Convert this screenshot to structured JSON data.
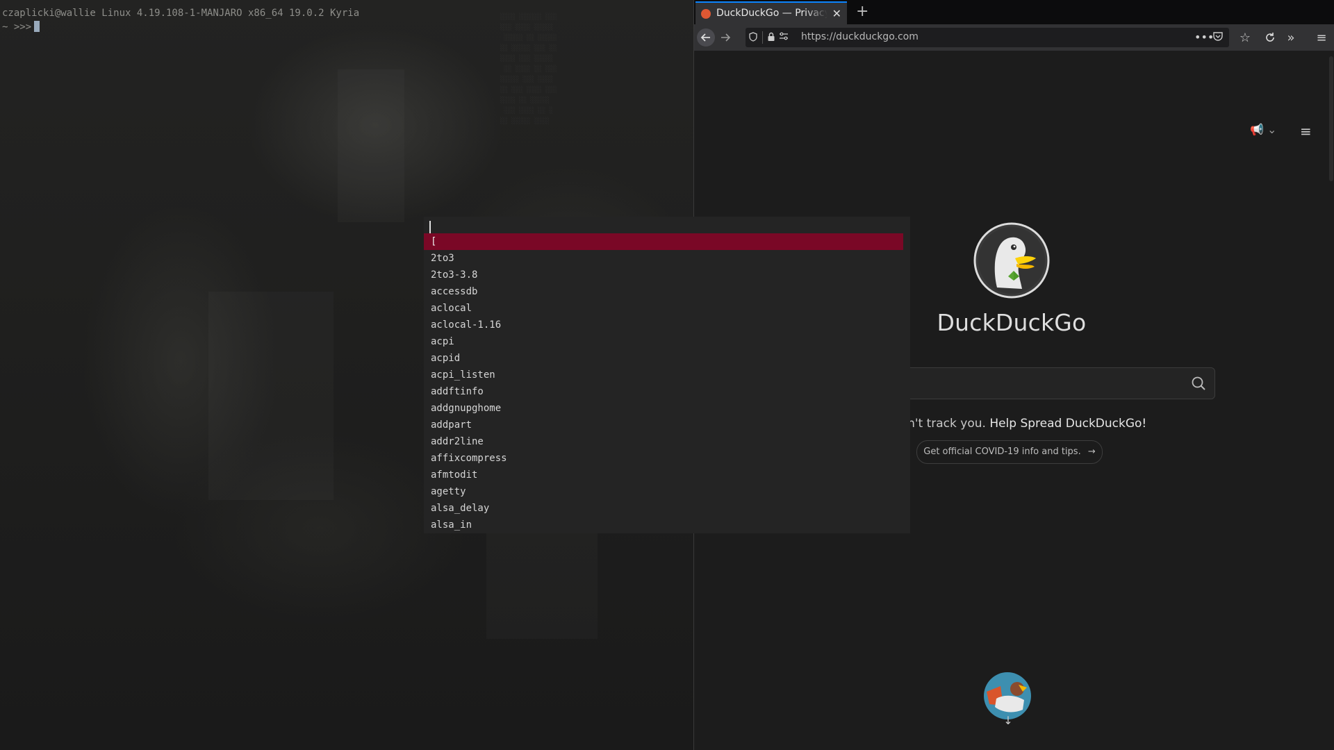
{
  "terminal": {
    "header_line": "czaplicki@wallie Linux 4.19.108-1-MANJARO x86_64 19.0.2 Kyria",
    "prompt": "~ >>>"
  },
  "launcher": {
    "query": "",
    "items": [
      "[",
      "2to3",
      "2to3-3.8",
      "accessdb",
      "aclocal",
      "aclocal-1.16",
      "acpi",
      "acpid",
      "acpi_listen",
      "addftinfo",
      "addgnupghome",
      "addpart",
      "addr2line",
      "affixcompress",
      "afmtodit",
      "agetty",
      "alsa_delay",
      "alsa_in"
    ],
    "selected_index": 0,
    "selected_color": "#7a0826"
  },
  "browser": {
    "tab": {
      "title": "DuckDuckGo — Privacy, simplified."
    },
    "new_tab_label": "+",
    "url": "https://duckduckgo.com",
    "page": {
      "brand": "DuckDuckGo",
      "search_placeholder": "",
      "tagline_start": "ne that doesn't track you.",
      "tagline_link": "Help Spread DuckDuckGo!",
      "covid_link": "Get official COVID-19 info and tips."
    },
    "accent_color": "#0a84ff"
  }
}
